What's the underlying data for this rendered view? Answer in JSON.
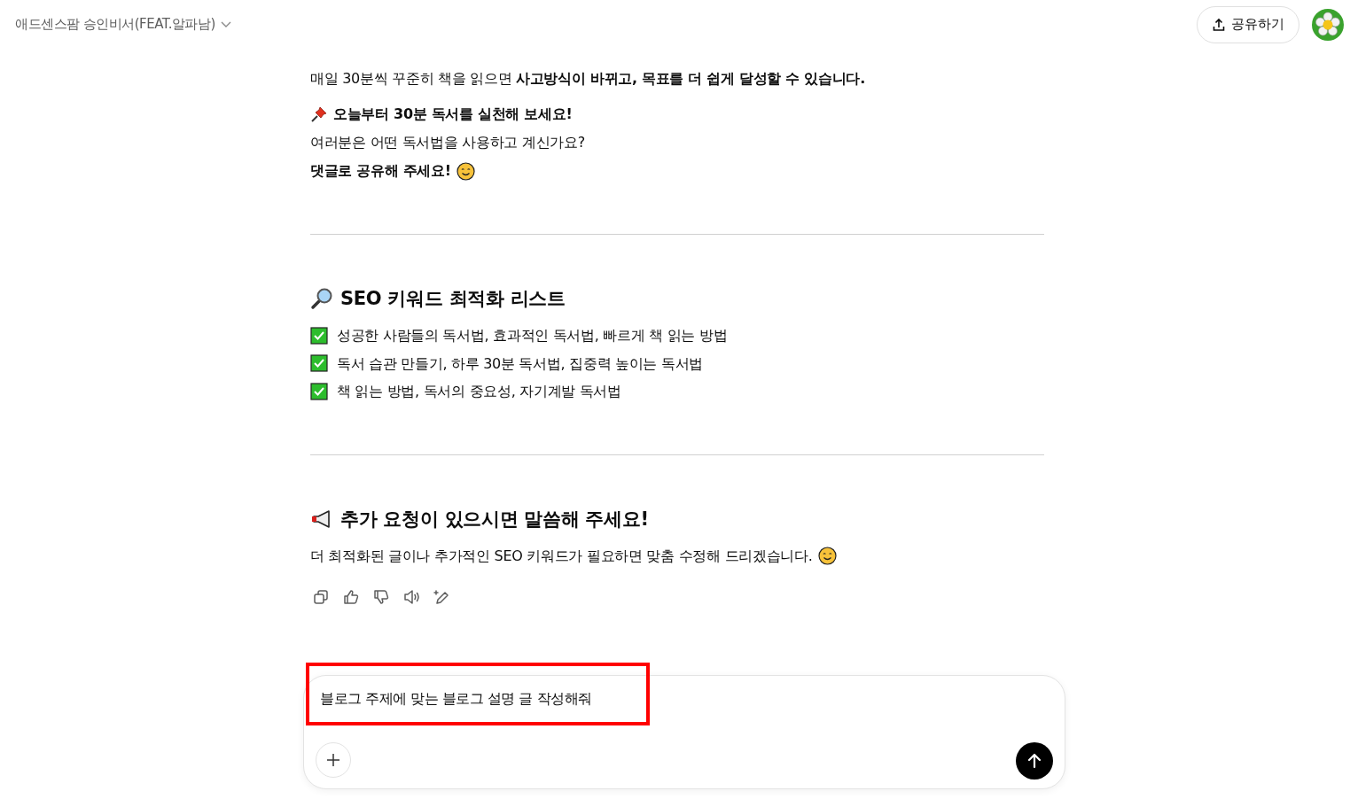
{
  "header": {
    "title": "애드센스팜 승인비서(FEAT.알파남)",
    "share_button": "공유하기"
  },
  "blocks": [
    {
      "kind": "paragraph",
      "text": "매일 30분씩 꾸준히 책을 읽으면 **사고방식이 바뀌고, 목표를 더 쉽게 달성할 수 있습니다.**"
    },
    {
      "kind": "pin_line",
      "text": "오늘부터 30분 독서를 실천해 보세요!"
    },
    {
      "kind": "paragraph",
      "text": "여러분은 어떤 독서법을 사용하고 계신가요?"
    },
    {
      "kind": "bold_line",
      "text": "댓글로 공유해 주세요!",
      "smiley": true
    },
    {
      "kind": "divider"
    },
    {
      "kind": "search_heading",
      "text": "SEO 키워드 최적화 리스트"
    },
    {
      "kind": "check_item",
      "text": "성공한 사람들의 독서법, 효과적인 독서법, 빠르게 책 읽는 방법"
    },
    {
      "kind": "check_item",
      "text": "독서 습관 만들기, 하루 30분 독서법, 집중력 높이는 독서법"
    },
    {
      "kind": "check_item",
      "text": "책 읽는 방법, 독서의 중요성, 자기계발 독서법"
    },
    {
      "kind": "divider"
    },
    {
      "kind": "announce_heading",
      "text": "추가 요청이 있으시면 말씀해 주세요!"
    },
    {
      "kind": "paragraph",
      "text": "더 최적화된 글이나 추가적인 SEO 키워드가 필요하면 맞춤 수정해 드리겠습니다.",
      "smiley": true
    }
  ],
  "composer": {
    "value": "블로그 주제에 맞는 블로그 설명 글 작성해줘",
    "highlighted": true
  }
}
